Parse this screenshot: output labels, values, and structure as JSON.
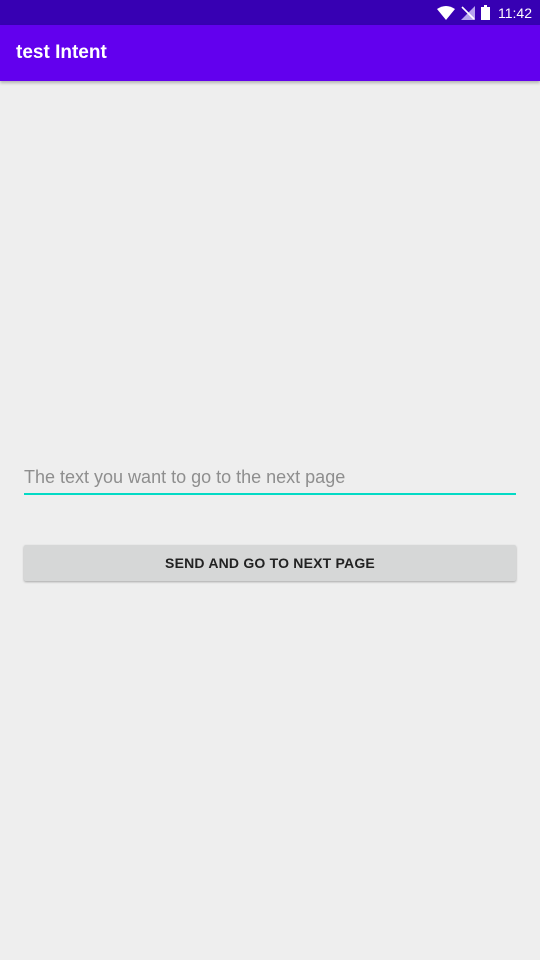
{
  "status_bar": {
    "time": "11:42",
    "icons": [
      "wifi-icon",
      "no-signal-icon",
      "battery-icon"
    ],
    "background_color": "#3700b3"
  },
  "app_bar": {
    "title": "test Intent",
    "background_color": "#6200ee"
  },
  "form": {
    "input_value": "",
    "input_placeholder": "The text you want to go to the next page",
    "button_label": "SEND AND GO TO NEXT PAGE",
    "accent_color": "#03dac5"
  }
}
